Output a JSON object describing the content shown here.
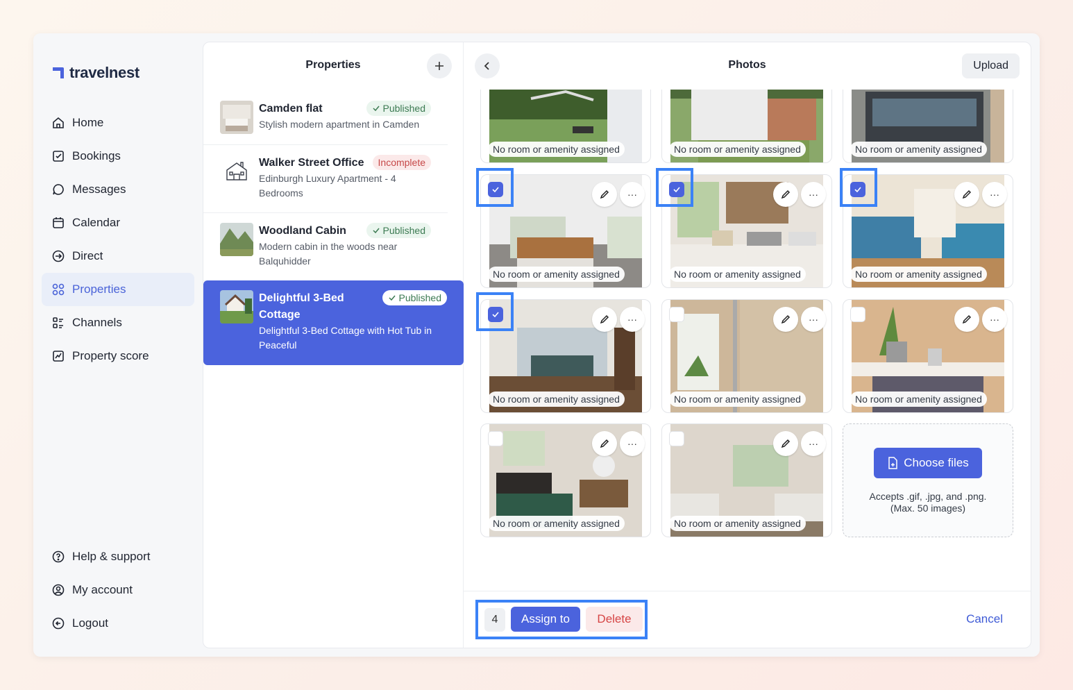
{
  "brand": {
    "name": "travelnest"
  },
  "nav": [
    {
      "label": "Home",
      "icon": "home-icon"
    },
    {
      "label": "Bookings",
      "icon": "bookings-icon"
    },
    {
      "label": "Messages",
      "icon": "messages-icon"
    },
    {
      "label": "Calendar",
      "icon": "calendar-icon"
    },
    {
      "label": "Direct",
      "icon": "direct-icon"
    },
    {
      "label": "Properties",
      "icon": "properties-icon",
      "active": true
    },
    {
      "label": "Channels",
      "icon": "channels-icon"
    },
    {
      "label": "Property score",
      "icon": "property-score-icon"
    }
  ],
  "nav_bottom": [
    {
      "label": "Help & support",
      "icon": "help-icon"
    },
    {
      "label": "My account",
      "icon": "account-icon"
    },
    {
      "label": "Logout",
      "icon": "logout-icon"
    }
  ],
  "properties": {
    "title": "Properties",
    "items": [
      {
        "name": "Camden flat",
        "desc": "Stylish modern apartment in Camden",
        "status": "Published"
      },
      {
        "name": "Walker Street Office",
        "desc": "Edinburgh Luxury Apartment - 4 Bedrooms",
        "status": "Incomplete"
      },
      {
        "name": "Woodland Cabin",
        "desc": "Modern cabin in the woods near Balquhidder",
        "status": "Published"
      },
      {
        "name": "Delightful 3-Bed Cottage",
        "desc": "Delightful 3-Bed Cottage with Hot Tub in Peaceful",
        "status": "Published",
        "selected": true
      }
    ]
  },
  "photos": {
    "title": "Photos",
    "upload_label": "Upload",
    "tag_text": "No room or amenity assigned",
    "choose_files": "Choose files",
    "accepts_line1": "Accepts .gif, .jpg, and .png.",
    "accepts_line2": "(Max. 50 images)"
  },
  "footer": {
    "selected_count": "4",
    "assign_label": "Assign to",
    "delete_label": "Delete",
    "cancel_label": "Cancel"
  },
  "colors": {
    "accent": "#4b63dd",
    "highlight": "#3b82f6",
    "published_bg": "#eaf5ee",
    "incomplete_bg": "#fbe9e9"
  }
}
